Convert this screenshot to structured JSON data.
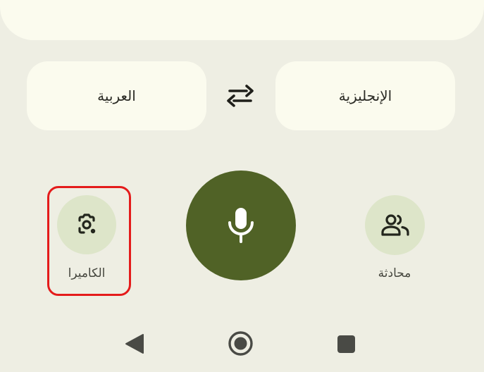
{
  "languages": {
    "source": "العربية",
    "target": "الإنجليزية"
  },
  "actions": {
    "camera_label": "الكاميرا",
    "conversation_label": "محادثة"
  },
  "icons": {
    "swap": "swap-arrows-icon",
    "camera": "camera-lens-icon",
    "microphone": "microphone-icon",
    "conversation": "people-icon",
    "back": "nav-back-icon",
    "home": "nav-home-icon",
    "recents": "nav-recents-icon"
  },
  "colors": {
    "background": "#eeeee3",
    "surface": "#fbfbee",
    "accent": "#506226",
    "tonal": "#dde5c9",
    "highlight": "#e41b1b"
  }
}
